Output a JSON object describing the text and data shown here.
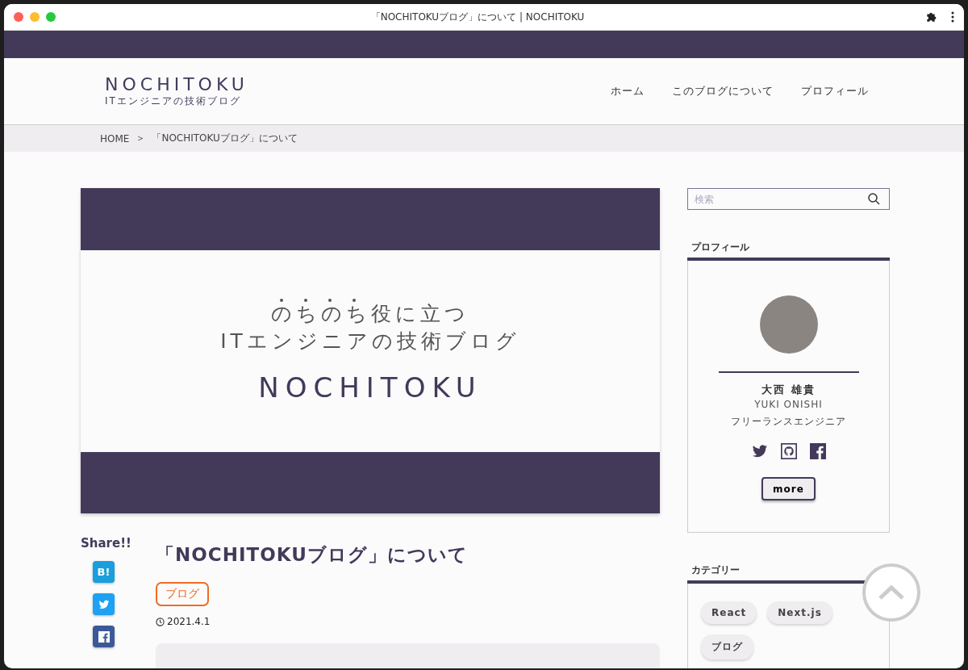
{
  "window": {
    "title": "「NOCHITOKUブログ」について | NOCHITOKU"
  },
  "site": {
    "name": "NOCHITOKU",
    "tagline": "ITエンジニアの技術ブログ"
  },
  "nav": [
    "ホーム",
    "このブログについて",
    "プロフィール"
  ],
  "breadcrumb": [
    "HOME",
    "＞",
    "「NOCHITOKUブログ」について"
  ],
  "hero": {
    "lines": [
      "のちのち役に立つ",
      "ITエンジニアの技術ブログ"
    ],
    "name": "NOCHITOKU"
  },
  "share": {
    "label": "Share!!",
    "buttons": [
      {
        "kind": "hatena",
        "label": "B!"
      },
      {
        "kind": "twitter"
      },
      {
        "kind": "facebook"
      }
    ]
  },
  "article": {
    "title": "「NOCHITOKUブログ」について",
    "category": "ブログ",
    "date": "2021.4.1"
  },
  "search": {
    "placeholder": "検索"
  },
  "profile": {
    "heading": "プロフィール",
    "name": "大西 雄貴",
    "romaji": "YUKI ONISHI",
    "role": "フリーランスエンジニア",
    "links": [
      {
        "kind": "twitter"
      },
      {
        "kind": "github"
      },
      {
        "kind": "facebook"
      }
    ],
    "more": "more"
  },
  "categories": {
    "heading": "カテゴリー",
    "tags": [
      "React",
      "Next.js",
      "ブログ"
    ]
  }
}
